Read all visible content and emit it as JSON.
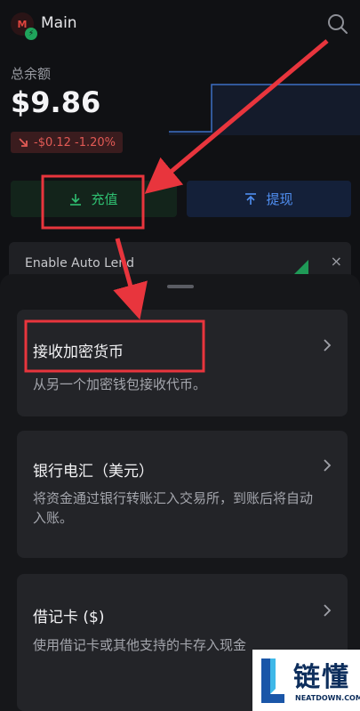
{
  "header": {
    "avatar_letter": "M",
    "account_name": "Main"
  },
  "balance": {
    "label": "总余额",
    "value": "$9.86",
    "change": "-$0.12 -1.20%"
  },
  "actions": {
    "deposit_label": "充值",
    "withdraw_label": "提现"
  },
  "promo": {
    "text": "Enable Auto Lend",
    "close": "×"
  },
  "sheet": {
    "options": [
      {
        "title": "接收加密货币",
        "description": "从另一个加密钱包接收代币。"
      },
      {
        "title": "银行电汇（美元）",
        "description": "将资金通过银行转账汇入交易所，到账后将自动入账。"
      },
      {
        "title": "借记卡 ($)",
        "description": "使用借记卡或其他支持的卡存入现金"
      }
    ]
  },
  "watermark": {
    "cn": "链懂",
    "en": "NEATDOWN.COM"
  },
  "colors": {
    "annotation": "#e8353d",
    "positive": "#2fbf71",
    "negative": "#e25a55",
    "accent_blue": "#4f8ef0"
  }
}
